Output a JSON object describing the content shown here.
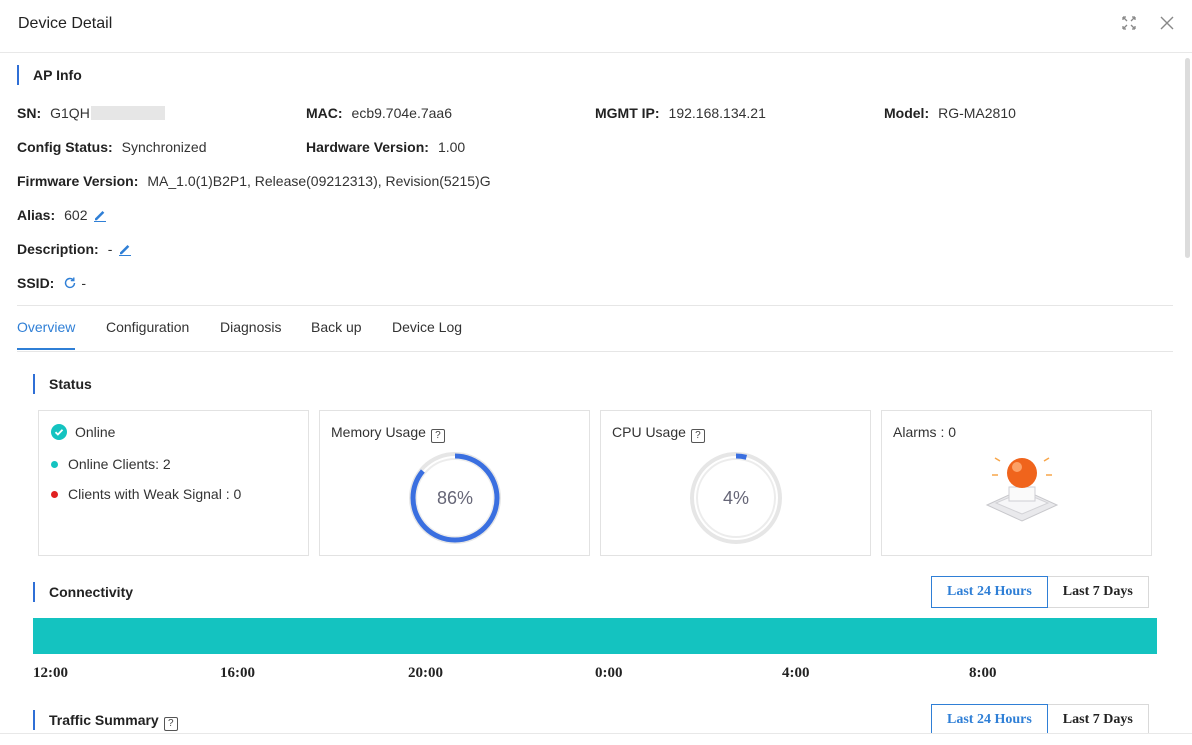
{
  "dialog": {
    "title": "Device Detail"
  },
  "ap_info": {
    "title": "AP Info",
    "sn_label": "SN:",
    "sn_value": "G1QH",
    "mac_label": "MAC:",
    "mac_value": "ecb9.704e.7aa6",
    "mgmt_label": "MGMT IP:",
    "mgmt_value": "192.168.134.21",
    "model_label": "Model:",
    "model_value": "RG-MA2810",
    "config_label": "Config Status:",
    "config_value": "Synchronized",
    "hw_label": "Hardware Version:",
    "hw_value": "1.00",
    "fw_label": "Firmware Version:",
    "fw_value": "MA_1.0(1)B2P1, Release(09212313), Revision(5215)G",
    "alias_label": "Alias:",
    "alias_value": "602",
    "desc_label": "Description:",
    "desc_value": "-",
    "ssid_label": "SSID:",
    "ssid_value": "-"
  },
  "tabs": [
    "Overview",
    "Configuration",
    "Diagnosis",
    "Back up",
    "Device Log"
  ],
  "status": {
    "title": "Status",
    "online_label": "Online",
    "online_clients": "Online Clients: 2",
    "weak_signal": "Clients with Weak Signal : 0",
    "memory_title": "Memory Usage",
    "memory_value": "86%",
    "memory_fraction": 0.86,
    "cpu_title": "CPU Usage",
    "cpu_value": "4%",
    "cpu_fraction": 0.04,
    "alarms_title": "Alarms : 0",
    "help_glyph": "?"
  },
  "connectivity": {
    "title": "Connectivity",
    "btn_24h": "Last 24 Hours",
    "btn_7d": "Last 7 Days",
    "ticks": [
      "12:00",
      "16:00",
      "20:00",
      "0:00",
      "4:00",
      "8:00"
    ]
  },
  "traffic": {
    "title": "Traffic Summary",
    "btn_24h": "Last 24 Hours",
    "btn_7d": "Last 7 Days"
  },
  "colors": {
    "accent": "#2f7fd6",
    "online": "#14c3c0",
    "weak": "#e02020",
    "gauge_memory": "#3a6fe0",
    "gauge_cpu": "#3a6fe0"
  }
}
